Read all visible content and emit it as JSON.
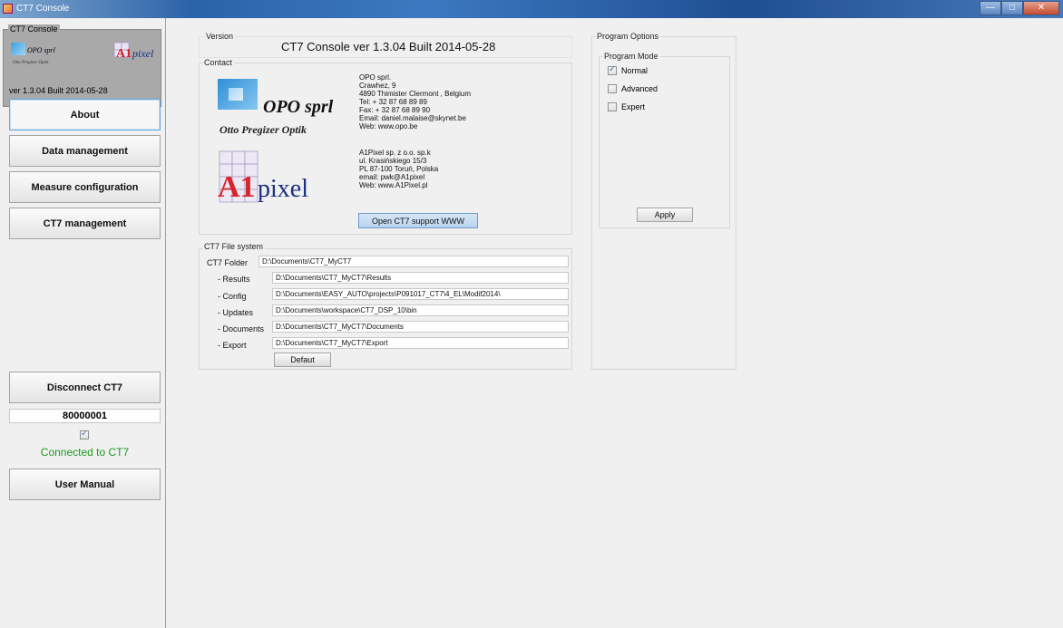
{
  "window": {
    "title": "CT7 Console",
    "buttons": {
      "minimize": "—",
      "maximize": "□",
      "close": "✕"
    }
  },
  "sidebar": {
    "group_title": "CT7 Console",
    "logo_opo_mini": "OPO sprl",
    "logo_opo_mini_sub": "Otto Pregizer Optik",
    "logo_a1_mini": "A1pixel",
    "version": "ver 1.3.04 Built 2014-05-28",
    "nav": [
      {
        "label": "About"
      },
      {
        "label": "Data management"
      },
      {
        "label": "Measure configuration"
      },
      {
        "label": "CT7 management"
      }
    ],
    "disconnect_label": "Disconnect  CT7",
    "serial": "80000001",
    "connected_checked": true,
    "status_text": "Connected to CT7",
    "user_manual_label": "User Manual"
  },
  "version_section": {
    "label": "Version",
    "title": "CT7 Console ver 1.3.04 Built 2014-05-28"
  },
  "contact": {
    "label": "Contact",
    "opo_logo_text": "OPO sprl",
    "opo_logo_sub": "Otto Pregizer Optik",
    "a1_logo_text": "A1pixel",
    "opo_lines": [
      "OPO sprl.",
      "Crawhez, 9",
      "4890 Thimister Clermont , Belgium",
      "Tel: + 32 87 68 89 89",
      "Fax: + 32 87 68 89 90",
      "Email: daniel.malaise@skynet.be",
      "Web: www.opo.be"
    ],
    "a1_lines": [
      "A1Pixel sp. z o.o. sp.k",
      "ul. Krasińskiego 15/3",
      "PL 87-100 Toruń, Polska",
      "email: pwk@A1pixel",
      "Web: www.A1Pixel.pl"
    ],
    "support_button": "Open CT7 support WWW"
  },
  "file_system": {
    "label": "CT7 File system",
    "rows": [
      {
        "label": "CT7 Folder",
        "value": "D:\\Documents\\CT7_MyCT7"
      },
      {
        "label": "- Results",
        "value": "D:\\Documents\\CT7_MyCT7\\Results"
      },
      {
        "label": "- Config",
        "value": "D:\\Documents\\EASY_AUTO\\projects\\P091017_CT7\\4_EL\\Modif2014\\"
      },
      {
        "label": "- Updates",
        "value": "D:\\Documents\\workspace\\CT7_DSP_10\\bin"
      },
      {
        "label": "- Documents",
        "value": "D:\\Documents\\CT7_MyCT7\\Documents"
      },
      {
        "label": "- Export",
        "value": "D:\\Documents\\CT7_MyCT7\\Export"
      }
    ],
    "default_button": "Defaut"
  },
  "program_options": {
    "label": "Program Options",
    "mode_label": "Program Mode",
    "modes": [
      {
        "label": "Normal",
        "checked": true
      },
      {
        "label": "Advanced",
        "checked": false
      },
      {
        "label": "Expert",
        "checked": false
      }
    ],
    "apply_button": "Apply"
  }
}
